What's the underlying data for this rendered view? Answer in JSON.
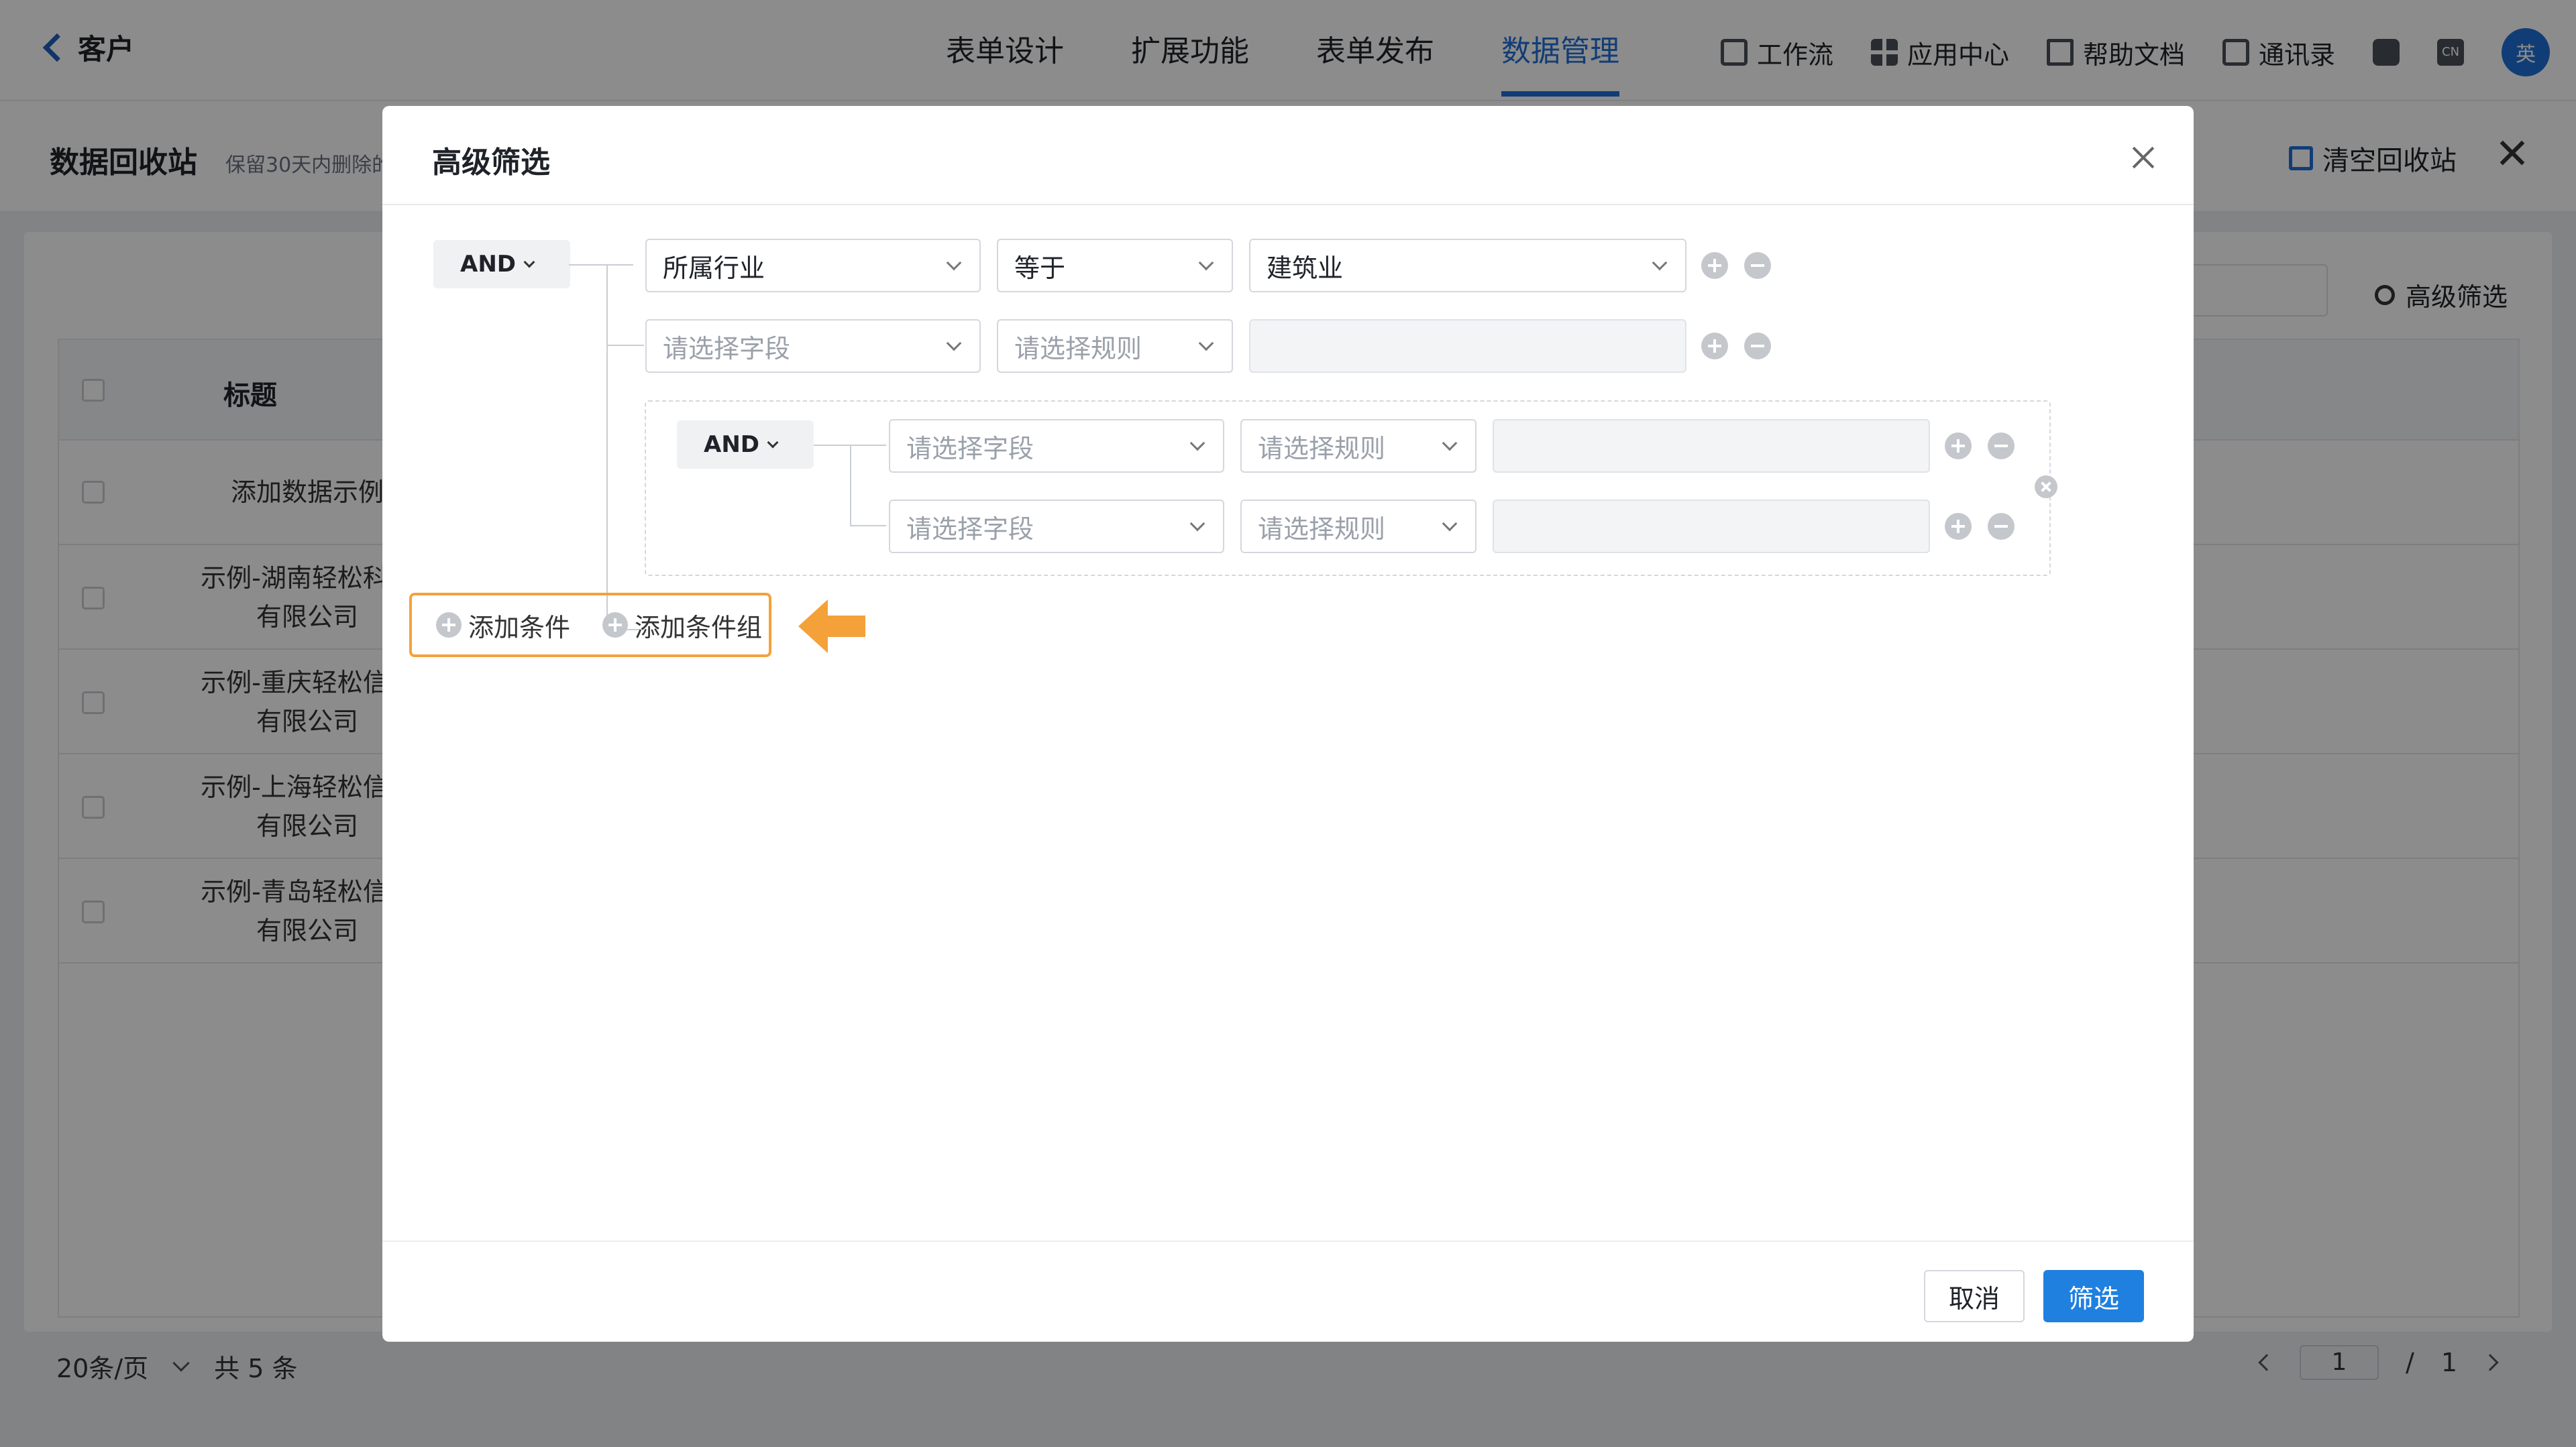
{
  "header": {
    "back_label": "客户",
    "tabs": [
      "表单设计",
      "扩展功能",
      "表单发布",
      "数据管理"
    ],
    "active_tab": "数据管理",
    "tools": [
      "工作流",
      "应用中心",
      "帮助文档",
      "通讯录"
    ],
    "cn_badge": "CN",
    "avatar_text": "英"
  },
  "recycle": {
    "title": "数据回收站",
    "hint": "保留30天内删除的",
    "clear_label": "清空回收站",
    "adv_filter_label": "高级筛选"
  },
  "table": {
    "header_title": "标题",
    "rows": [
      {
        "line1": "添加数据示例",
        "line2": ""
      },
      {
        "line1": "示例-湖南轻松科技",
        "line2": "有限公司"
      },
      {
        "line1": "示例-重庆轻松信息",
        "line2": "有限公司"
      },
      {
        "line1": "示例-上海轻松信息",
        "line2": "有限公司"
      },
      {
        "line1": "示例-青岛轻松信息",
        "line2": "有限公司"
      }
    ]
  },
  "pagination": {
    "page_size": "20条/页",
    "total": "共 5 条",
    "current": "1",
    "separator": "/",
    "pages": "1"
  },
  "modal": {
    "title": "高级筛选",
    "root_logic": "AND",
    "conditions": [
      {
        "field": "所属行业",
        "rule": "等于",
        "value": "建筑业"
      },
      {
        "field": "请选择字段",
        "rule": "请选择规则",
        "value": ""
      }
    ],
    "group": {
      "logic": "AND",
      "conditions": [
        {
          "field": "请选择字段",
          "rule": "请选择规则",
          "value": ""
        },
        {
          "field": "请选择字段",
          "rule": "请选择规则",
          "value": ""
        }
      ]
    },
    "add_condition_label": "添加条件",
    "add_group_label": "添加条件组",
    "cancel_label": "取消",
    "confirm_label": "筛选"
  },
  "colors": {
    "accent": "#1f80e0",
    "highlight": "#f5a13a"
  }
}
